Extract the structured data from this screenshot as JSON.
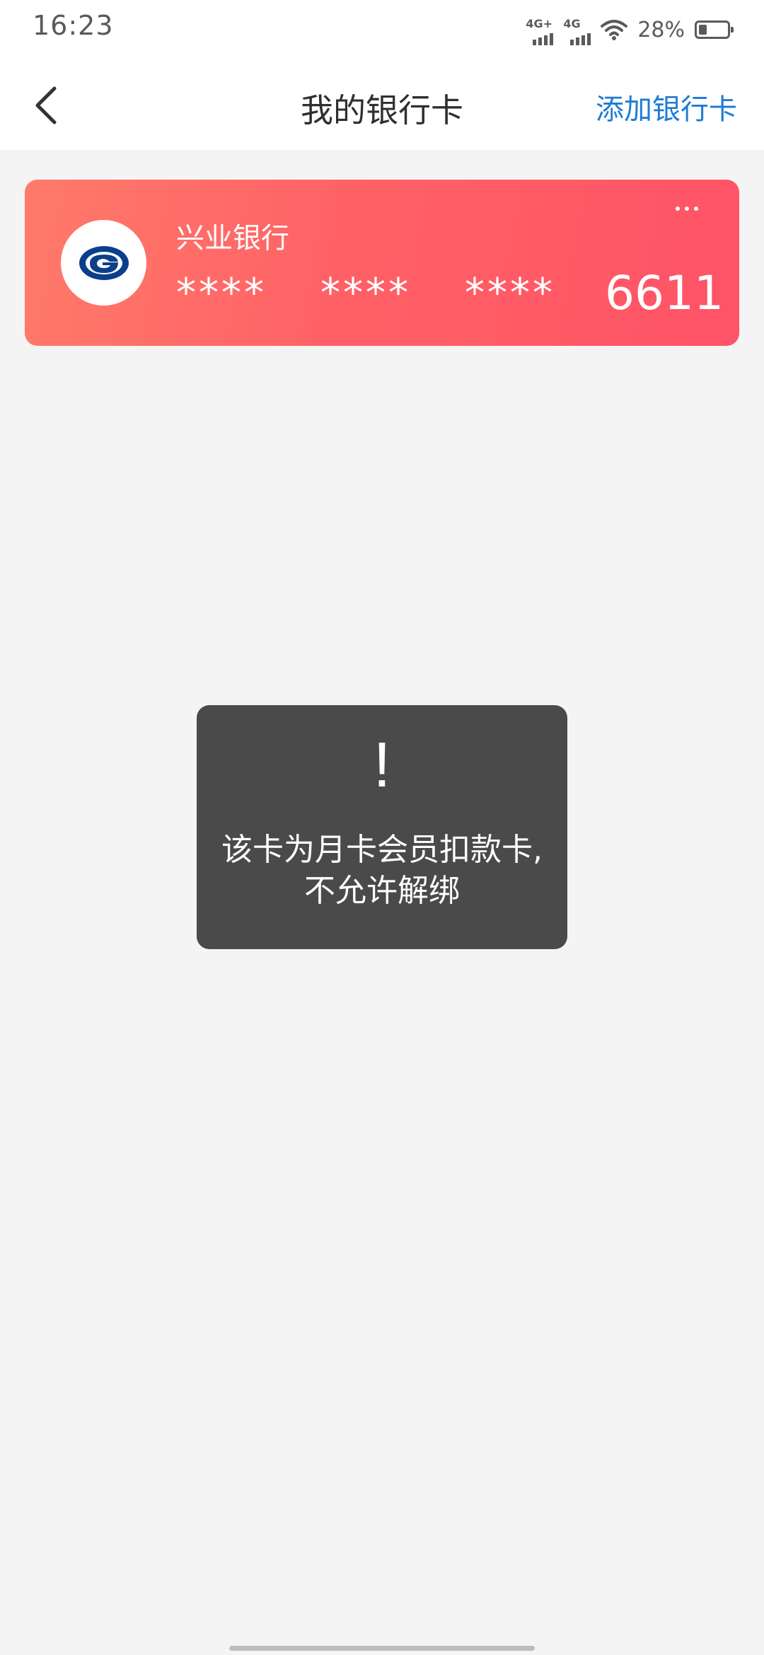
{
  "status_bar": {
    "time": "16:23",
    "sim1": "4G+",
    "sim2": "4G",
    "battery_percent": "28%",
    "battery_level": 0.28
  },
  "nav": {
    "title": "我的银行卡",
    "add_card": "添加银行卡",
    "back_icon": "chevron-left-icon"
  },
  "card": {
    "bank_name": "兴业银行",
    "mask_1": "****",
    "mask_2": "****",
    "mask_3": "****",
    "last4": "6611",
    "logo_icon": "bank-logo-icon",
    "more_icon": "more-dots-icon",
    "gradient_start": "#ff7a6a",
    "gradient_end": "#ff5367"
  },
  "toast": {
    "icon": "!",
    "message": "该卡为月卡会员扣款卡,不允许解绑"
  },
  "colors": {
    "accent": "#1f7bd6",
    "background": "#f4f4f4",
    "toast_bg": "#4a4a4a"
  }
}
